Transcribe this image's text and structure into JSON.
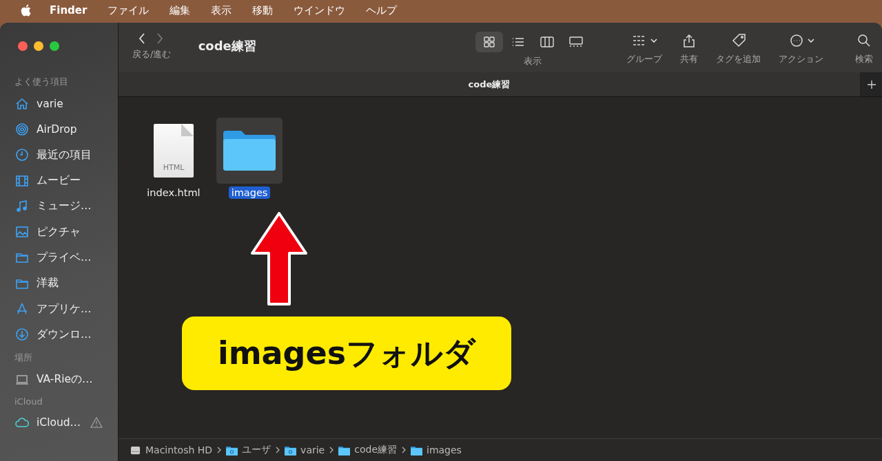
{
  "menu_bar": {
    "app": "Finder",
    "items": [
      "ファイル",
      "編集",
      "表示",
      "移動",
      "ウインドウ",
      "ヘルプ"
    ]
  },
  "sidebar": {
    "sections": [
      {
        "title": "よく使う項目",
        "items": [
          {
            "label": "varie",
            "kind": "home"
          },
          {
            "label": "AirDrop",
            "kind": "airdrop"
          },
          {
            "label": "最近の項目",
            "kind": "recent"
          },
          {
            "label": "ムービー",
            "kind": "movie"
          },
          {
            "label": "ミュージ…",
            "kind": "music"
          },
          {
            "label": "ピクチャ",
            "kind": "picture"
          },
          {
            "label": "プライベ…",
            "kind": "folder"
          },
          {
            "label": "洋裁",
            "kind": "folder"
          },
          {
            "label": "アプリケ…",
            "kind": "apps"
          },
          {
            "label": "ダウンロ…",
            "kind": "download"
          }
        ]
      },
      {
        "title": "場所",
        "items": [
          {
            "label": "VA-Rieの…",
            "kind": "laptop"
          }
        ]
      },
      {
        "title": "iCloud",
        "items": [
          {
            "label": "iCloud…",
            "kind": "cloud",
            "warning": true
          }
        ]
      }
    ]
  },
  "toolbar": {
    "nav_label": "戻る/進む",
    "title": "code練習",
    "view_label": "表示",
    "views": [
      {
        "kind": "icons",
        "selected": true
      },
      {
        "kind": "list",
        "selected": false
      },
      {
        "kind": "columns",
        "selected": false
      },
      {
        "kind": "gallery",
        "selected": false
      }
    ],
    "actions": [
      {
        "kind": "group",
        "label": "グループ"
      },
      {
        "kind": "share",
        "label": "共有"
      },
      {
        "kind": "tag",
        "label": "タグを追加"
      },
      {
        "kind": "action",
        "label": "アクション"
      },
      {
        "kind": "search",
        "label": "検索"
      }
    ]
  },
  "tab_bar": {
    "title": "code練習"
  },
  "files": [
    {
      "name": "index.html",
      "kind": "html",
      "badge": "HTML",
      "selected": false
    },
    {
      "name": "images",
      "kind": "folder",
      "selected": true
    }
  ],
  "annotation": {
    "callout": "imagesフォルダ"
  },
  "path_bar": [
    {
      "label": "Macintosh HD",
      "kind": "disk"
    },
    {
      "label": "ユーザ",
      "kind": "user-folder"
    },
    {
      "label": "varie",
      "kind": "home-folder"
    },
    {
      "label": "code練習",
      "kind": "folder"
    },
    {
      "label": "images",
      "kind": "folder"
    }
  ]
}
